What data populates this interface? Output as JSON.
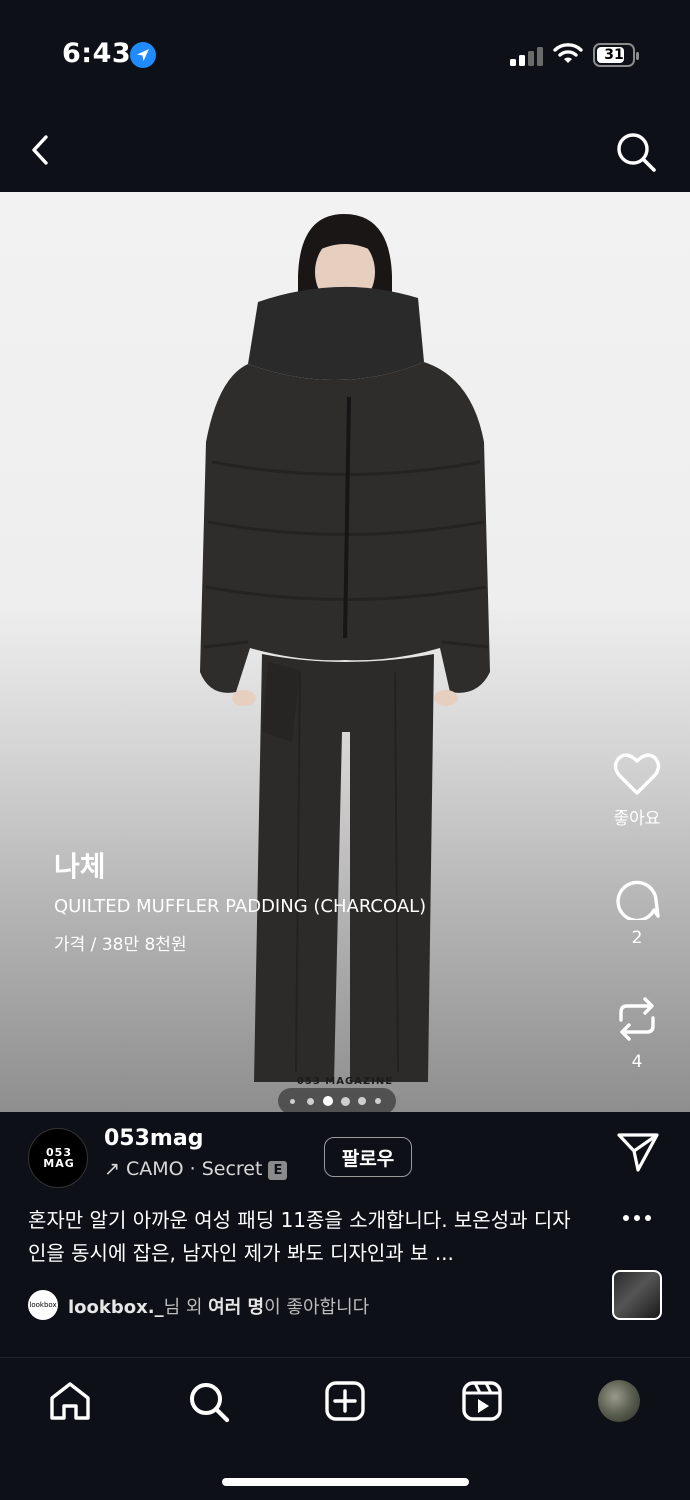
{
  "status_bar": {
    "time": "6:43",
    "battery": "31"
  },
  "post_overlay": {
    "brand": "나체",
    "product": "QUILTED MUFFLER PADDING (CHARCOAL)",
    "price": "가격 / 38만 8천원",
    "watermark": "053 MAGAZINE"
  },
  "side_actions": {
    "like_label": "좋아요",
    "comment_count": "2",
    "repost_count": "4"
  },
  "carousel": {
    "count": 6,
    "active_index": 2
  },
  "post": {
    "username": "053mag",
    "avatar_text": "053 MAG",
    "music": "↗ CAMO · Secret",
    "explicit_badge": "E",
    "follow_label": "팔로우",
    "caption": "혼자만 알기 아까운 여성 패딩 11종을 소개합니다. 보온성과 디자인을 동시에 잡은, 남자인 제가 봐도 디자인과 보 ...",
    "liked_avatar_text": "lookbox",
    "liked_by_user": "lookbox._",
    "liked_by_middle": "님 외 ",
    "liked_by_others": "여러 명",
    "liked_by_suffix": "이 좋아합니다"
  },
  "icons": {
    "back": "chevron-left-icon",
    "search": "search-icon",
    "like": "heart-icon",
    "comment": "comment-icon",
    "repost": "repost-icon",
    "share": "send-icon",
    "more": "more-horizontal-icon",
    "tab_home": "home-icon",
    "tab_search": "search-icon",
    "tab_create": "plus-square-icon",
    "tab_reels": "reels-icon"
  }
}
